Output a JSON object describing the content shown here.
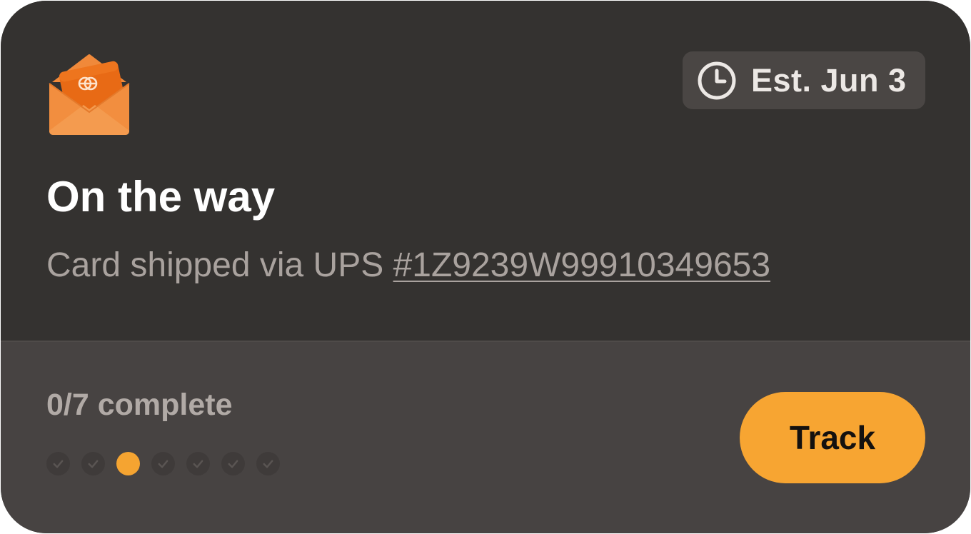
{
  "eta": {
    "icon": "clock-icon",
    "label": "Est. Jun 3"
  },
  "status": {
    "icon": "envelope-card-icon",
    "title": "On the way",
    "subtitle_prefix": "Card shipped via UPS ",
    "tracking_number": "#1Z9239W99910349653"
  },
  "progress": {
    "label": "0/7 complete",
    "total_steps": 7,
    "completed_steps": 0,
    "active_step": 3
  },
  "actions": {
    "track_label": "Track"
  },
  "colors": {
    "card_top": "#343230",
    "card_bottom": "#474342",
    "accent": "#f7a532",
    "muted_text": "#a9a29e"
  }
}
